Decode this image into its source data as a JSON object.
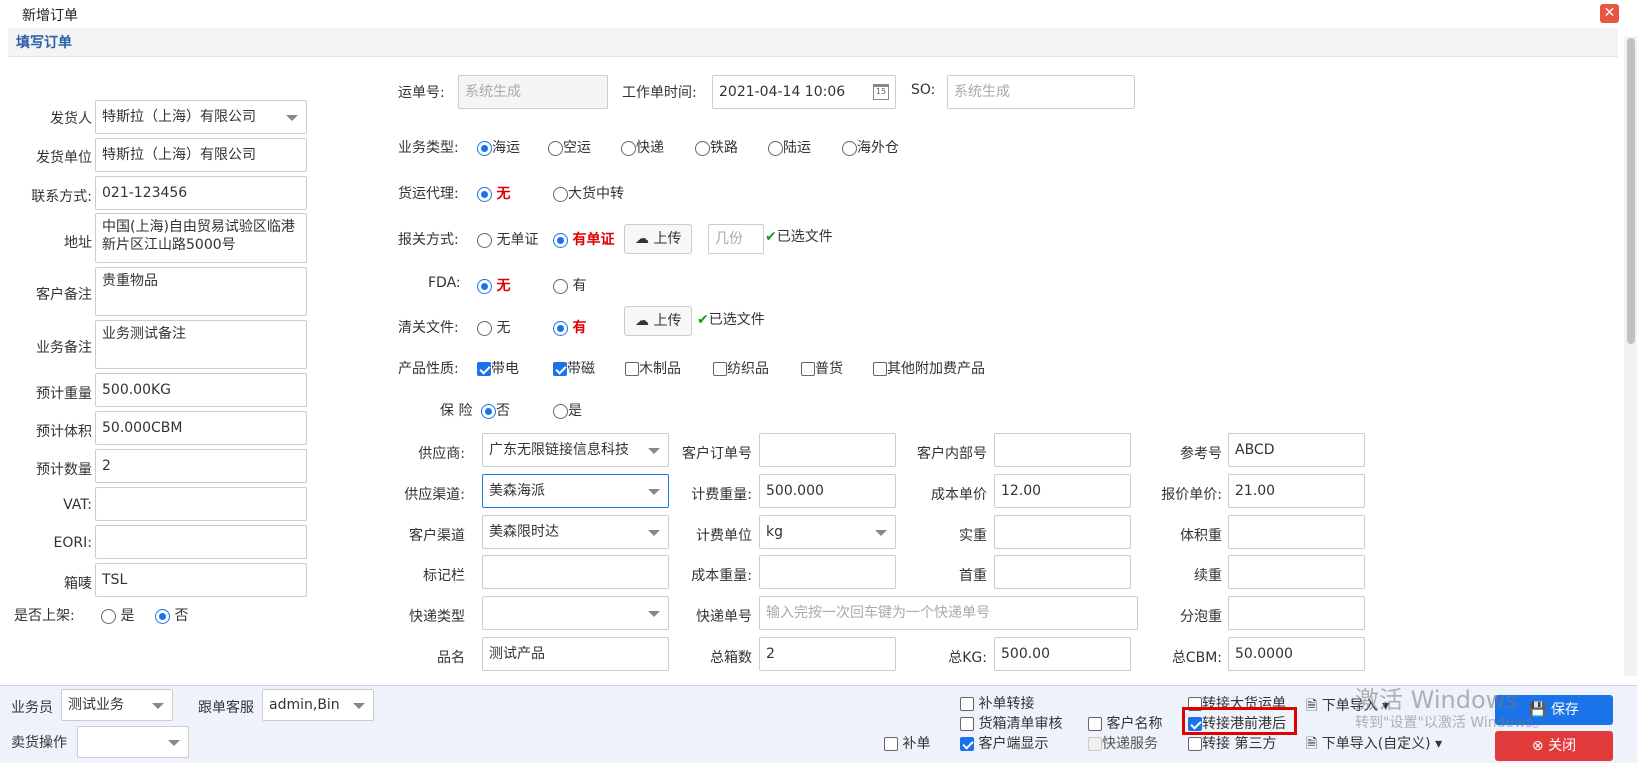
{
  "window": {
    "title": "新增订单",
    "section": "填写订单"
  },
  "left": {
    "shipper": {
      "label": "发货人",
      "value": "特斯拉（上海）有限公司"
    },
    "unit": {
      "label": "发货单位",
      "value": "特斯拉（上海）有限公司"
    },
    "contact": {
      "label": "联系方式:",
      "value": "021-123456"
    },
    "address": {
      "label": "地址",
      "value": "中国(上海)自由贸易试验区临港新片区江山路5000号"
    },
    "cust_note": {
      "label": "客户备注",
      "value": "贵重物品"
    },
    "biz_note": {
      "label": "业务备注",
      "value": "业务测试备注"
    },
    "weight": {
      "label": "预计重量",
      "value": "500.00KG"
    },
    "volume": {
      "label": "预计体积",
      "value": "50.000CBM"
    },
    "qty": {
      "label": "预计数量",
      "value": "2"
    },
    "vat": {
      "label": "VAT:",
      "value": ""
    },
    "eori": {
      "label": "EORI:",
      "value": ""
    },
    "mark": {
      "label": "箱唛",
      "value": "TSL"
    },
    "shelf": {
      "label": "是否上架:",
      "yes": "是",
      "no": "否"
    }
  },
  "top": {
    "waybill": {
      "label": "运单号:",
      "placeholder": "系统生成"
    },
    "worktime": {
      "label": "工作单时间:",
      "value": "2021-04-14 10:06"
    },
    "so": {
      "label": "SO:",
      "placeholder": "系统生成"
    }
  },
  "biz_type": {
    "label": "业务类型:",
    "options": [
      "海运",
      "空运",
      "快递",
      "铁路",
      "陆运",
      "海外仓"
    ]
  },
  "agent": {
    "label": "货运代理:",
    "options": [
      "无",
      "大货中转"
    ]
  },
  "customs": {
    "label": "报关方式:",
    "options": [
      "无单证",
      "有单证"
    ],
    "upload": "上传",
    "copies_placeholder": "几份",
    "selected": "已选文件"
  },
  "fda": {
    "label": "FDA:",
    "options": [
      "无",
      "有"
    ]
  },
  "clearance": {
    "label": "清关文件:",
    "options": [
      "无",
      "有"
    ],
    "upload": "上传",
    "selected": "已选文件"
  },
  "product": {
    "label": "产品性质:",
    "options": [
      "带电",
      "带磁",
      "木制品",
      "纺织品",
      "普货",
      "其他附加费产品"
    ]
  },
  "insurance": {
    "label": "保 险",
    "options": [
      "否",
      "是"
    ]
  },
  "grid": {
    "supplier": {
      "label": "供应商:",
      "value": "广东无限链接信息科技"
    },
    "cust_order": {
      "label": "客户订单号",
      "value": ""
    },
    "cust_internal": {
      "label": "客户内部号",
      "value": ""
    },
    "ref": {
      "label": "参考号",
      "value": "ABCD"
    },
    "channel": {
      "label": "供应渠道:",
      "value": "美森海派"
    },
    "charge_weight": {
      "label": "计费重量:",
      "value": "500.000"
    },
    "cost_price": {
      "label": "成本单价",
      "value": "12.00"
    },
    "quote_price": {
      "label": "报价单价:",
      "value": "21.00"
    },
    "cust_channel": {
      "label": "客户渠道",
      "value": "美森限时达"
    },
    "charge_unit": {
      "label": "计费单位",
      "value": "kg"
    },
    "real_weight": {
      "label": "实重",
      "value": ""
    },
    "vol_weight": {
      "label": "体积重",
      "value": ""
    },
    "remark": {
      "label": "标记栏",
      "value": ""
    },
    "cost_weight": {
      "label": "成本重量:",
      "value": ""
    },
    "first_weight": {
      "label": "首重",
      "value": ""
    },
    "cont_weight": {
      "label": "续重",
      "value": ""
    },
    "express_type": {
      "label": "快递类型",
      "value": ""
    },
    "express_no": {
      "label": "快递单号",
      "placeholder": "输入完按一次回车键为一个快递单号"
    },
    "split": {
      "label": "分泡重",
      "value": ""
    },
    "product_name": {
      "label": "品名",
      "value": "测试产品"
    },
    "boxes": {
      "label": "总箱数",
      "value": "2"
    },
    "total_kg": {
      "label": "总KG:",
      "value": "500.00"
    },
    "total_cbm": {
      "label": "总CBM:",
      "value": "50.0000"
    }
  },
  "bottom": {
    "salesman": {
      "label": "业务员",
      "value": "测试业务"
    },
    "follow": {
      "label": "跟单客服",
      "value": "admin,Bin"
    },
    "seller": {
      "label": "卖货操作",
      "value": ""
    },
    "checks": {
      "supplement": "补单",
      "supplement_transfer": "补单转接",
      "cargo_review": "货箱清单审核",
      "cust_display": "客户端显示",
      "cust_name": "客户名称",
      "express_service": "快递服务",
      "bulk_transfer": "转接大货运单",
      "port_transfer": "转接港前港后",
      "third_transfer": "转接 第三方"
    },
    "import": "下单导入",
    "import_custom": "下单导入(自定义)",
    "save": "保存",
    "close": "关闭"
  },
  "watermark": {
    "line1": "激活 Windows",
    "line2": "转到\"设置\"以激活 Windows。"
  }
}
